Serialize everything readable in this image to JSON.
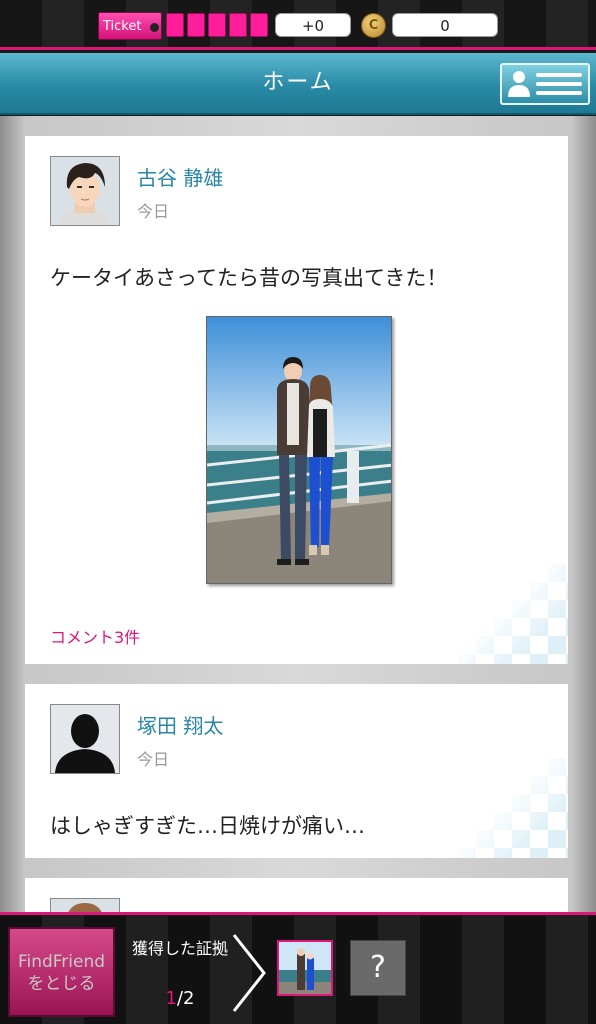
{
  "status": {
    "ticket_label": "Ticket",
    "ticket_slots": 5,
    "ticket_counter": "+0",
    "coin_symbol": "C",
    "coin_count": "0"
  },
  "header": {
    "title": "ホーム"
  },
  "posts": [
    {
      "author": "古谷 静雄",
      "time": "今日",
      "text": "ケータイあさってたら昔の写真出てきた！",
      "comments": "コメント3件"
    },
    {
      "author": "塚田 翔太",
      "time": "今日",
      "text": "はしゃぎすぎた…日焼けが痛い…"
    }
  ],
  "bottom": {
    "findfriend_line1": "FindFriend",
    "findfriend_line2": "をとじる",
    "evidence_label": "獲得した証拠",
    "evidence_current": "1",
    "evidence_total": "/2",
    "unknown_symbol": "?"
  },
  "colors": {
    "accent_pink": "#e0157a",
    "header_teal": "#2a8aa6",
    "author_blue": "#2a86a6"
  }
}
